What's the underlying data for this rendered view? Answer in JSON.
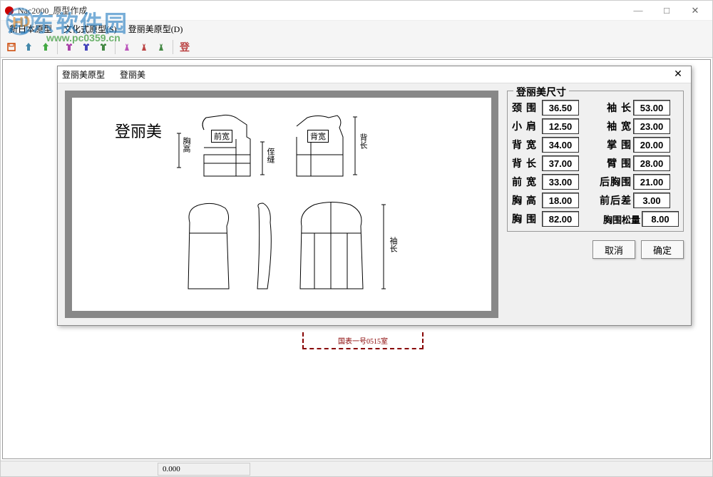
{
  "watermark": {
    "text": "河东软件园",
    "url": "www.pc0359.cn"
  },
  "window": {
    "title": "Nac2000_原型作成",
    "controls": {
      "min": "—",
      "max": "□",
      "close": "✕"
    }
  },
  "menu": {
    "items": [
      "新日本原型",
      "文化式原型(S)",
      "登丽美原型(D)"
    ]
  },
  "statusbar": {
    "value": "0.000"
  },
  "bg_stamp": "国表一号0515室",
  "dialog": {
    "title_a": "登丽美原型",
    "title_b": "登丽美",
    "close": "✕",
    "diagram": {
      "title": "登丽美",
      "front_width": "前宽",
      "bust_height": "胸高",
      "seam": "侄缝",
      "back_width": "背宽",
      "back_length": "背长",
      "sleeve_length": "袖长"
    },
    "fieldset_title": "登丽美尺寸",
    "sizes": {
      "neck": {
        "label": "颈围",
        "value": "36.50"
      },
      "sleeve_len": {
        "label": "袖 长",
        "value": "53.00"
      },
      "shoulder": {
        "label": "小肩",
        "value": "12.50"
      },
      "sleeve_w": {
        "label": "袖 宽",
        "value": "23.00"
      },
      "back_w": {
        "label": "背宽",
        "value": "34.00"
      },
      "palm": {
        "label": "掌 围",
        "value": "20.00"
      },
      "back_l": {
        "label": "背长",
        "value": "37.00"
      },
      "arm": {
        "label": "臂 围",
        "value": "28.00"
      },
      "front_w": {
        "label": "前宽",
        "value": "33.00"
      },
      "back_bust": {
        "label": "后胸围",
        "value": "21.00"
      },
      "bust_h": {
        "label": "胸高",
        "value": "18.00"
      },
      "fb_diff": {
        "label": "前后差",
        "value": "3.00"
      },
      "bust": {
        "label": "胸围",
        "value": "82.00"
      },
      "bust_ease": {
        "label": "胸围松量",
        "value": "8.00"
      }
    },
    "buttons": {
      "cancel": "取消",
      "ok": "确定"
    }
  }
}
